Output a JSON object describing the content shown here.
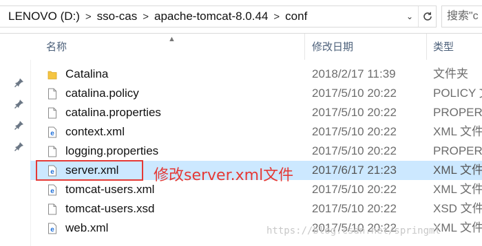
{
  "breadcrumb": {
    "items": [
      {
        "label": "LENOVO (D:)"
      },
      {
        "label": "sso-cas"
      },
      {
        "label": "apache-tomcat-8.0.44"
      },
      {
        "label": "conf"
      }
    ]
  },
  "search": {
    "placeholder": "搜索\"c"
  },
  "columns": {
    "name": "名称",
    "date": "修改日期",
    "type": "类型"
  },
  "files": [
    {
      "name": "Catalina",
      "date": "2018/2/17 11:39",
      "type": "文件夹",
      "icon": "folder-icon"
    },
    {
      "name": "catalina.policy",
      "date": "2017/5/10 20:22",
      "type": "POLICY 文",
      "icon": "document-icon"
    },
    {
      "name": "catalina.properties",
      "date": "2017/5/10 20:22",
      "type": "PROPERT",
      "icon": "document-icon"
    },
    {
      "name": "context.xml",
      "date": "2017/5/10 20:22",
      "type": "XML 文件",
      "icon": "xml-file-icon"
    },
    {
      "name": "logging.properties",
      "date": "2017/5/10 20:22",
      "type": "PROPERT",
      "icon": "document-icon"
    },
    {
      "name": "server.xml",
      "date": "2017/6/17 21:23",
      "type": "XML 文件",
      "icon": "xml-file-icon",
      "selected": true
    },
    {
      "name": "tomcat-users.xml",
      "date": "2017/5/10 20:22",
      "type": "XML 文件",
      "icon": "xml-file-icon"
    },
    {
      "name": "tomcat-users.xsd",
      "date": "2017/5/10 20:22",
      "type": "XSD 文件",
      "icon": "document-icon"
    },
    {
      "name": "web.xml",
      "date": "2017/5/10 20:22",
      "type": "XML 文件",
      "icon": "xml-file-icon"
    }
  ],
  "annotation": {
    "text": "修改server.xml文件",
    "color": "#e53935"
  },
  "watermark": "https://blog.csdn.net/springml",
  "colors": {
    "selection": "#cce8ff",
    "header_text": "#4c607a",
    "folder": "#f5c542",
    "ie_blue": "#1e6fd9"
  }
}
